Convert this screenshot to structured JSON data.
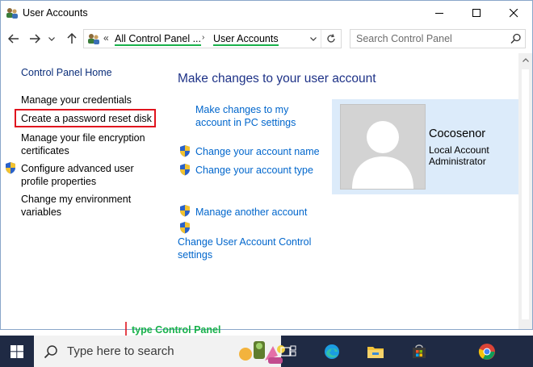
{
  "window": {
    "title": "User Accounts"
  },
  "address": {
    "overflow_chevron": "«",
    "crumbs": [
      "All Control Panel ...",
      "User Accounts"
    ],
    "separator": "›"
  },
  "search": {
    "placeholder": "Search Control Panel"
  },
  "sidebar": {
    "home": "Control Panel Home",
    "items": [
      {
        "label": "Manage your credentials"
      },
      {
        "label": "Create a password reset disk"
      },
      {
        "label": "Manage your file encryption",
        "label2": "certificates"
      },
      {
        "label": "Configure advanced user",
        "label2": "profile properties"
      },
      {
        "label": "Change my environment",
        "label2": "variables"
      }
    ]
  },
  "main": {
    "heading": "Make changes to your user account",
    "links": {
      "pc_settings_1": "Make changes to my",
      "pc_settings_2": "account in PC settings",
      "change_name": "Change your account name",
      "change_type": "Change your account type",
      "manage_other": "Manage another account",
      "uac_1": "Change User Account Control",
      "uac_2": "settings"
    }
  },
  "user": {
    "name": "Cocosenor",
    "account_type": "Local Account",
    "role": "Administrator"
  },
  "annotation": {
    "text": "type Control Panel",
    "color": "#19b24b"
  },
  "taskbar": {
    "search_placeholder": "Type here to search",
    "apps": [
      "task-view-icon",
      "edge-icon",
      "file-explorer-icon",
      "store-icon",
      "chrome-icon"
    ]
  },
  "colors": {
    "link": "#0066cc",
    "heading": "#1e3287",
    "highlight": "#e0141e",
    "user_card": "#dcebfa",
    "taskbar": "#1f2a44"
  }
}
